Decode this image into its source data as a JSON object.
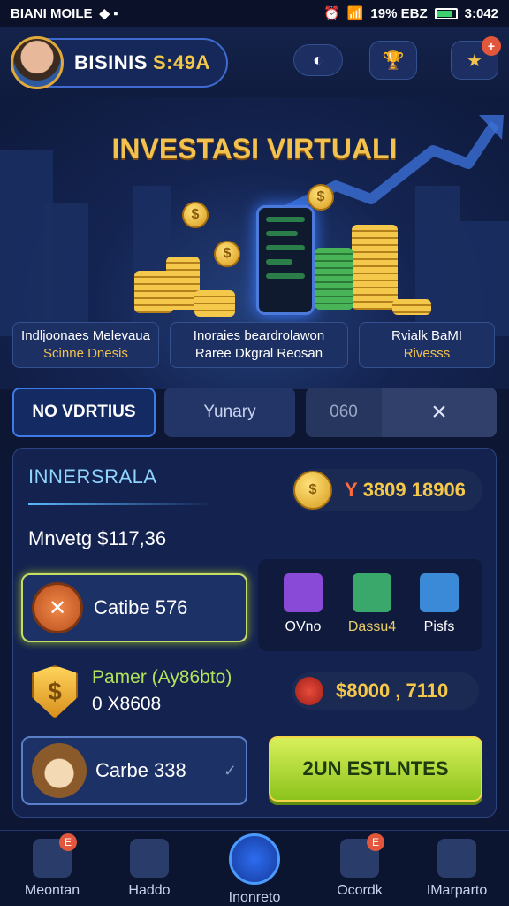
{
  "status_bar": {
    "carrier": "BIANI MOILE",
    "battery_text": "19% EBZ",
    "time": "3:042"
  },
  "header": {
    "name": "BISINIS",
    "amount": "S:49A"
  },
  "hero": {
    "title": "INVESTASI VIRTUALI"
  },
  "features": [
    {
      "line1": "Indljoonaes Melevaua",
      "line2": "Scinne Dnesis"
    },
    {
      "line1": "Inoraies beardrolawon",
      "line2": "Raree Dkgral Reosan"
    },
    {
      "line1": "Rvialk BaMI",
      "line2": "Rivesss"
    }
  ],
  "tabs": {
    "active": "NO VDRTIUS",
    "second": "Yunary",
    "search_value": "060",
    "close_icon": "×"
  },
  "panel": {
    "section_title": "INNERSRALA",
    "balance_prefix": "Y",
    "balance": "3809 18906",
    "market": "Mnvetg $117,36",
    "shop": [
      {
        "label": "OVno",
        "color": "#8a4ad8"
      },
      {
        "label": "Dassu4",
        "color": "#3aa86a"
      },
      {
        "label": "Pisfs",
        "color": "#3a8ad8"
      }
    ],
    "card1": "Catibe 576",
    "payment_label": "Pamer (Ay86bto)",
    "payment_value": "0 X8608",
    "price": "$8000 , 7110",
    "card2": "Carbe 338",
    "cta": "2UN ESTLNTES"
  },
  "nav": [
    {
      "label": "Meontan",
      "badge": "E"
    },
    {
      "label": "Haddo",
      "badge": ""
    },
    {
      "label": "Inonreto",
      "badge": ""
    },
    {
      "label": "Ocordk",
      "badge": "E"
    },
    {
      "label": "IMarparto",
      "badge": ""
    }
  ]
}
